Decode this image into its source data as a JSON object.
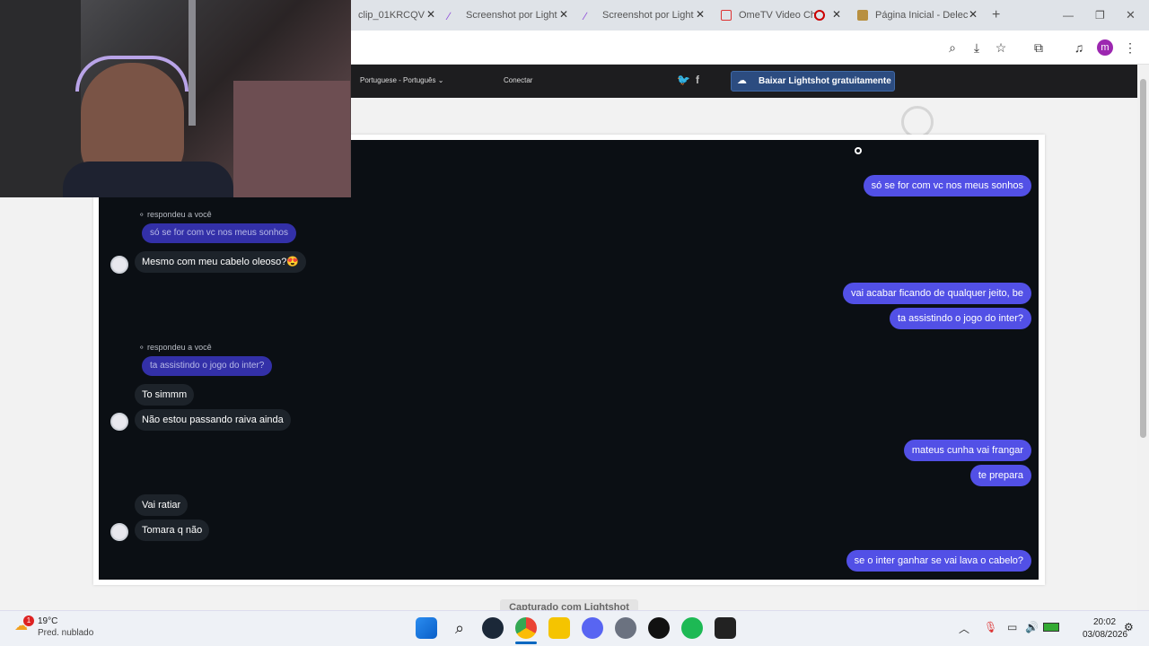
{
  "tabs": [
    {
      "label": "clip_01KRCQV"
    },
    {
      "label": "Screenshot por Light"
    },
    {
      "label": "Screenshot por Light"
    },
    {
      "label": "OmeTV Video Ch"
    },
    {
      "label": "Página Inicial - Delec"
    }
  ],
  "new_tab": "+",
  "lightshot": {
    "language": "Portuguese - Português",
    "connect": "Conectar",
    "download": "Baixar Lightshot gratuitamente",
    "captured": "Capturado com Lightshot"
  },
  "chat": {
    "left_replied": "respondeu a você",
    "left": [
      {
        "quote": "só se for com vc nos meus sonhos",
        "msgs": [
          "Mesmo com meu cabelo oleoso?😍"
        ]
      },
      {
        "quote": "ta assistindo o jogo do inter?",
        "msgs": [
          "To simmm",
          "Não estou passando raiva ainda"
        ]
      },
      {
        "quote": "",
        "msgs": [
          "Vai ratiar",
          "Tomara q não"
        ]
      }
    ],
    "right": [
      "só se for com vc nos meus sonhos",
      "vai acabar ficando de qualquer jeito, be",
      "ta assistindo o jogo do inter?",
      "mateus cunha vai frangar",
      "te prepara",
      "se o inter ganhar se vai lava o cabelo?"
    ]
  },
  "weather": {
    "temp": "19°C",
    "desc": "Pred. nublado",
    "badge": "1"
  },
  "clock": {
    "time": "20:02",
    "date": "03/08/2026"
  },
  "profile_initial": "m",
  "accent": "#5250e6"
}
